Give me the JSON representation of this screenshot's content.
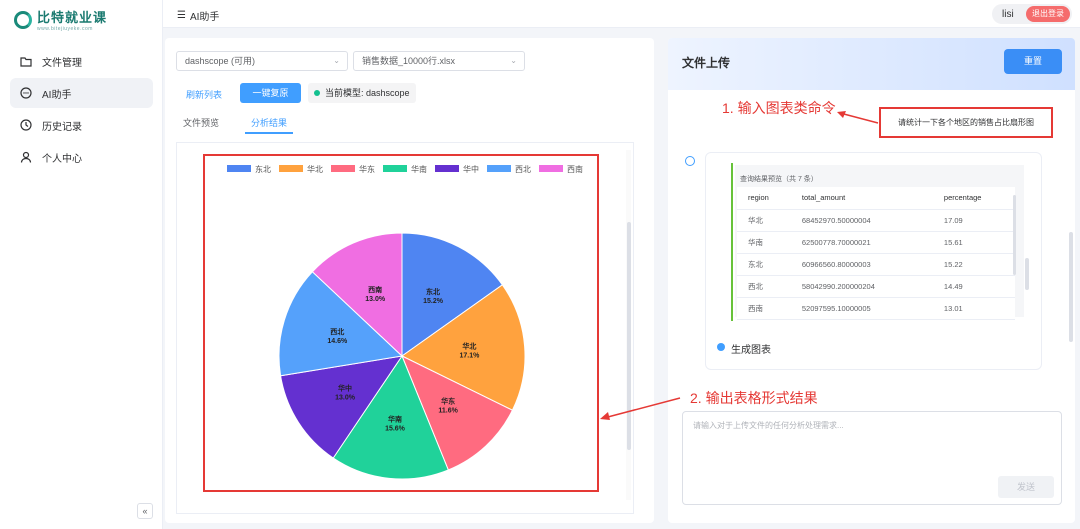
{
  "logo": {
    "title": "比特就业课",
    "subtitle": "www.bitejiuyeke.com"
  },
  "sidebar": {
    "items": [
      {
        "label": "文件管理",
        "icon": "folder-icon"
      },
      {
        "label": "AI助手",
        "icon": "chat-icon"
      },
      {
        "label": "历史记录",
        "icon": "clock-icon"
      },
      {
        "label": "个人中心",
        "icon": "user-icon"
      }
    ],
    "collapse_label": "«"
  },
  "header": {
    "breadcrumb": "AI助手",
    "menu_icon": "menu-icon",
    "username": "lisi",
    "logout_label": "退出登录"
  },
  "controls": {
    "provider": "dashscope (可用)",
    "file": "销售数据_10000行.xlsx",
    "refresh_label": "刷新列表",
    "restore_label": "一键复原",
    "model_label": "当前模型: dashscope"
  },
  "tabs": [
    {
      "label": "文件预览"
    },
    {
      "label": "分析结果"
    }
  ],
  "chart_data": {
    "type": "pie",
    "categories": [
      "东北",
      "华北",
      "华东",
      "华南",
      "华中",
      "西北",
      "西南"
    ],
    "values": [
      15.2,
      17.1,
      11.6,
      15.6,
      13.0,
      14.6,
      13.0
    ],
    "labels": [
      "15.2%",
      "17.1%",
      "11.6%",
      "15.6%",
      "13.0%",
      "14.6%",
      "13.0%"
    ],
    "colors": [
      "#4f85f2",
      "#ffa23e",
      "#ff6b80",
      "#20d29a",
      "#6430d0",
      "#55a1fb",
      "#f06ee2"
    ],
    "legend": "top"
  },
  "right_panel": {
    "title": "文件上传",
    "reset_label": "重置",
    "annotation1": "1. 输入图表类命令",
    "annotation2": "2. 输出表格形式结果",
    "user_command": "请统计一下各个地区的销售占比扇形图",
    "result_title": "查询结果预览（共 7 条）",
    "columns": [
      "region",
      "total_amount",
      "percentage"
    ],
    "rows": [
      [
        "华北",
        "68452970.50000004",
        "17.09"
      ],
      [
        "华南",
        "62500778.70000021",
        "15.61"
      ],
      [
        "东北",
        "60966560.80000003",
        "15.22"
      ],
      [
        "西北",
        "58042990.200000204",
        "14.49"
      ],
      [
        "西南",
        "52097595.10000005",
        "13.01"
      ]
    ],
    "step_label": "生成图表",
    "input_placeholder": "请输入对于上传文件的任何分析处理需求...",
    "send_label": "发送"
  }
}
